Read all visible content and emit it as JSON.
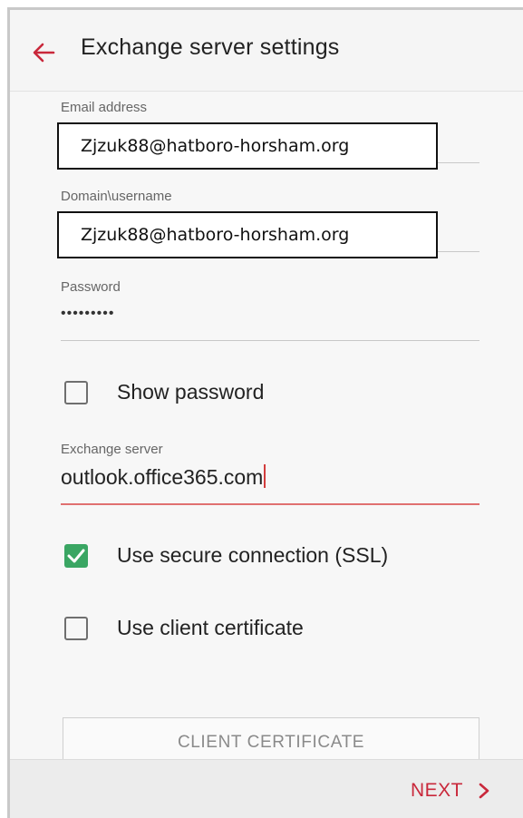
{
  "header": {
    "title": "Exchange server settings",
    "back_icon": "arrow-left-icon",
    "accent_color": "#c9283b"
  },
  "email": {
    "label": "Email address",
    "value": "Zjzuk88@hatboro-horsham.org"
  },
  "domain_username": {
    "label": "Domain\\username",
    "value": "Zjzuk88@hatboro-horsham.org"
  },
  "password": {
    "label": "Password",
    "value": "•••••••••"
  },
  "show_password": {
    "label": "Show password",
    "checked": false
  },
  "exchange_server": {
    "label": "Exchange server",
    "value": "outlook.office365.com"
  },
  "ssl": {
    "label": "Use secure connection (SSL)",
    "checked": true,
    "check_color": "#3aa663"
  },
  "client_certificate": {
    "label": "Use client certificate",
    "checked": false,
    "button_label": "CLIENT CERTIFICATE"
  },
  "footer": {
    "next_label": "NEXT",
    "next_icon": "chevron-right-icon"
  }
}
